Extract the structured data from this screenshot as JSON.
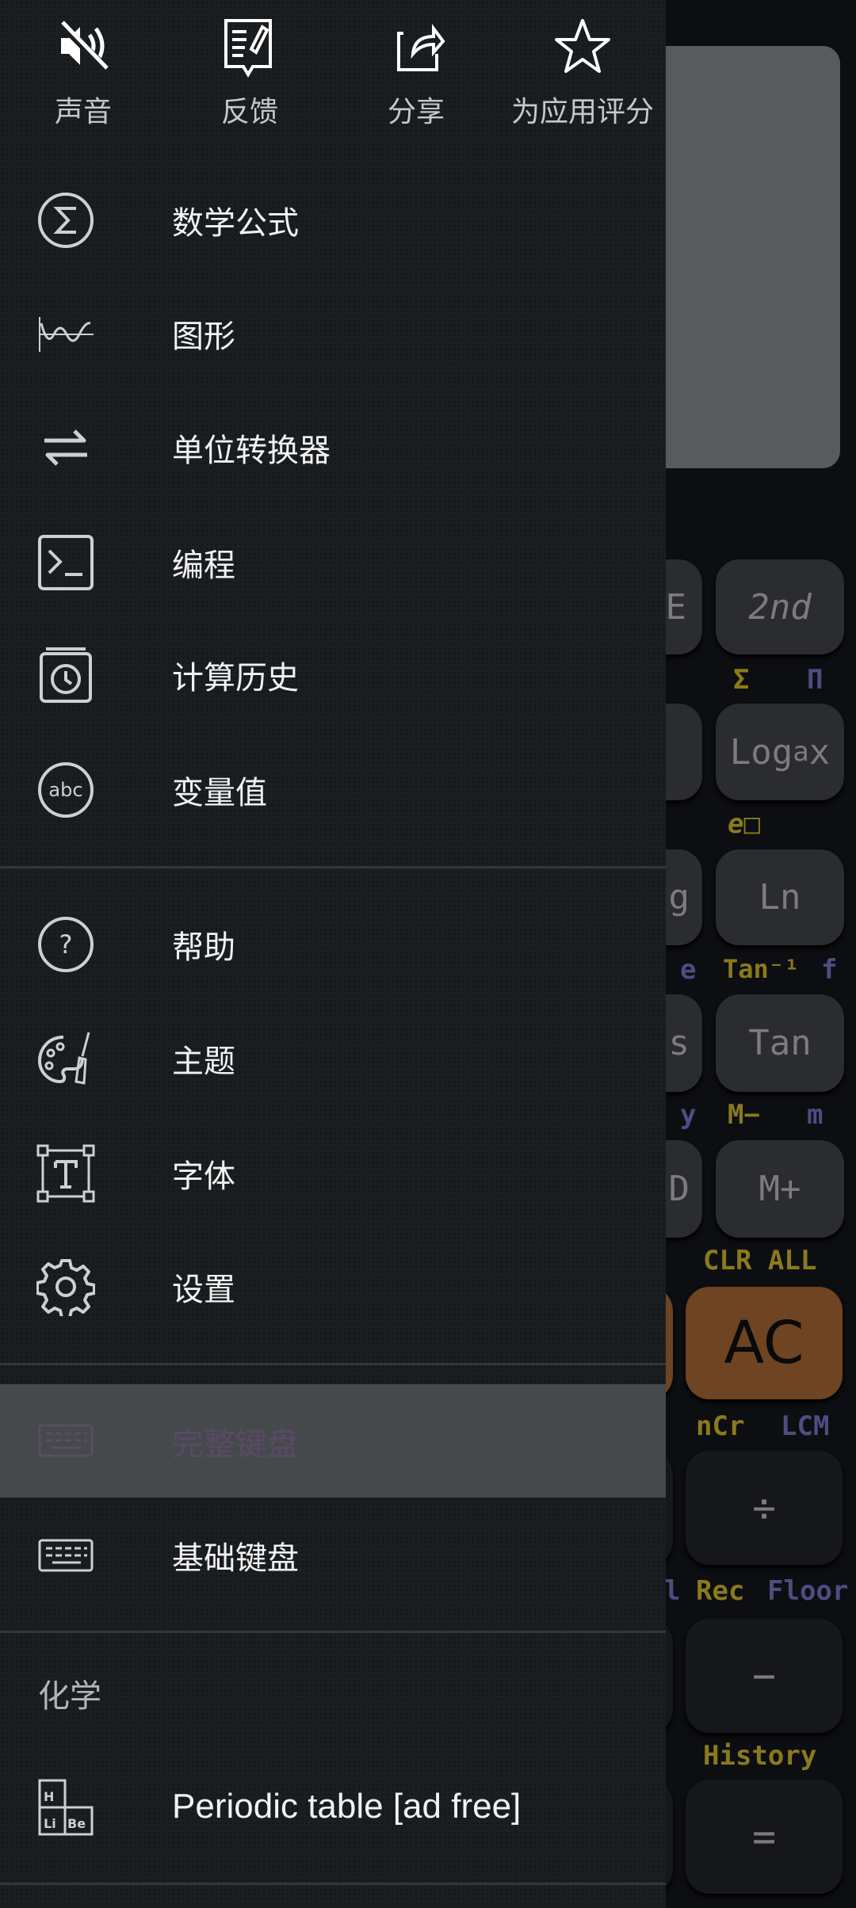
{
  "top_actions": [
    {
      "label": "声音",
      "icon": "sound-off-icon"
    },
    {
      "label": "反馈",
      "icon": "feedback-icon"
    },
    {
      "label": "分享",
      "icon": "share-icon"
    },
    {
      "label": "为应用评分",
      "icon": "star-icon"
    }
  ],
  "menu": {
    "group1": [
      {
        "label": "数学公式",
        "icon": "sigma-icon"
      },
      {
        "label": "图形",
        "icon": "graph-icon"
      },
      {
        "label": "单位转换器",
        "icon": "convert-arrows-icon"
      },
      {
        "label": "编程",
        "icon": "terminal-icon"
      },
      {
        "label": "计算历史",
        "icon": "history-icon"
      },
      {
        "label": "变量值",
        "icon": "abc-icon"
      }
    ],
    "group2": [
      {
        "label": "帮助",
        "icon": "help-icon"
      },
      {
        "label": "主题",
        "icon": "palette-icon"
      },
      {
        "label": "字体",
        "icon": "font-icon"
      },
      {
        "label": "设置",
        "icon": "gear-icon"
      }
    ],
    "keyboards": [
      {
        "label": "完整键盘",
        "icon": "keyboard-icon",
        "selected": true
      },
      {
        "label": "基础键盘",
        "icon": "keyboard-icon",
        "selected": false
      }
    ],
    "chem_section": "化学",
    "periodic": {
      "label": "Periodic table [ad free]",
      "icon": "periodic-table-icon"
    }
  },
  "calculator": {
    "keys": {
      "k2nd": "2nd",
      "loga": "Log",
      "loga_sub": "a",
      "loga_x": "x",
      "ln": "Ln",
      "tan": "Tan",
      "mplus": "M+",
      "ac": "AC",
      "div": "÷",
      "minus": "−",
      "eq": "=",
      "left_e": "E",
      "left_g": "g",
      "left_s": "s",
      "left_o": "D"
    },
    "labels": {
      "sigma": "Σ",
      "pi": "Π",
      "e_pow": "e□",
      "e": "e",
      "atan": "Tan⁻¹",
      "f": "f",
      "y": "y",
      "mminus": "M−",
      "m": "m",
      "clr_all": "CLR ALL",
      "ncr": "nCr",
      "lcm": "LCM",
      "l": "l",
      "rec": "Rec",
      "floor": "Floor",
      "history": "History"
    },
    "colors": {
      "secondary": "#8a7a1c",
      "tertiary": "#4f4c80",
      "ac": "#6e4422"
    }
  }
}
